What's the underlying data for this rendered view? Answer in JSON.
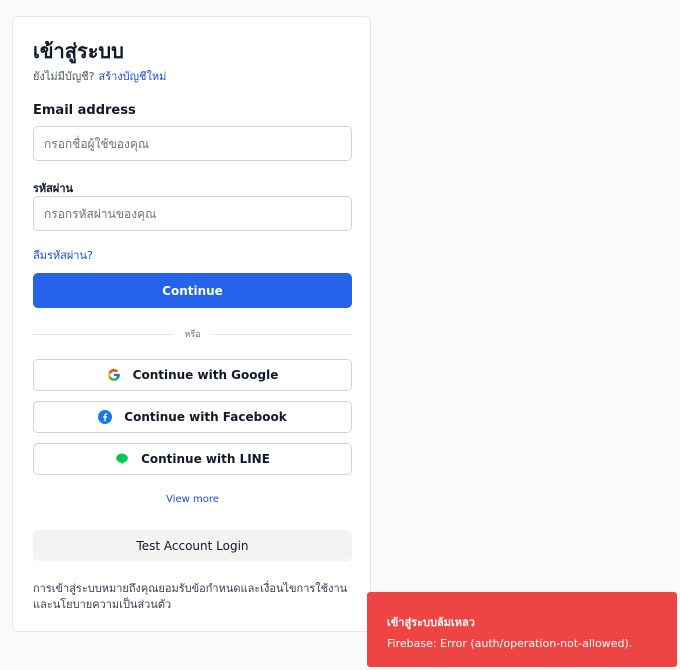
{
  "login": {
    "title": "เข้าสู่ระบบ",
    "no_account": "ยังไม่มีบัญชี?",
    "create_account": "สร้างบัญชีใหม่",
    "email_label": "Email address",
    "email_placeholder": "กรอกชื่อผู้ใช้ของคุณ",
    "email_value": "",
    "password_label": "รหัสผ่าน",
    "password_placeholder": "กรอกรหัสผ่านของคุณ",
    "password_value": "",
    "forgot_password": "ลืมรหัสผ่าน?",
    "continue_label": "Continue",
    "divider_text": "หรือ",
    "social": {
      "google": "Continue with Google",
      "facebook": "Continue with Facebook",
      "line": "Continue with LINE"
    },
    "view_more": "View more",
    "test_login": "Test Account Login",
    "terms": "การเข้าสู่ระบบหมายถึงคุณยอมรับข้อกำหนดและเงื่อนไขการใช้งานและนโยบายความเป็นส่วนตัว"
  },
  "toast": {
    "title": "เข้าสู่ระบบล้มเหลว",
    "message": "Firebase: Error (auth/operation-not-allowed)."
  },
  "colors": {
    "primary": "#2563eb",
    "link": "#1d4ed8",
    "error": "#ef4444",
    "facebook": "#1877f2",
    "line": "#06c755"
  },
  "icons": {
    "google": "google-icon",
    "facebook": "facebook-icon",
    "line": "line-icon"
  }
}
